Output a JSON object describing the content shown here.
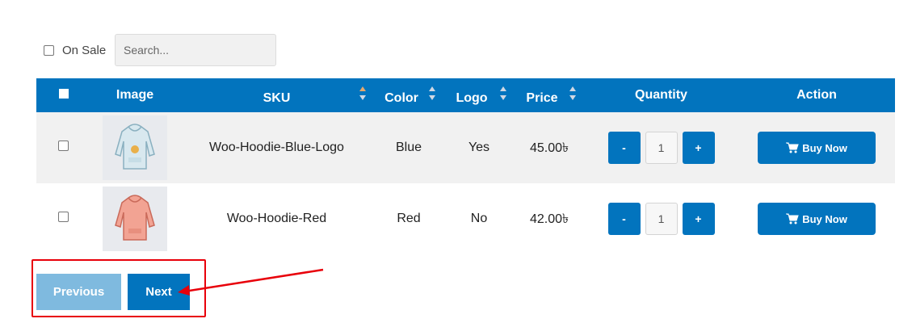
{
  "filters": {
    "on_sale_label": "On Sale",
    "search_placeholder": "Search..."
  },
  "table": {
    "headers": {
      "image": "Image",
      "sku": "SKU",
      "color": "Color",
      "logo": "Logo",
      "price": "Price",
      "quantity": "Quantity",
      "action": "Action"
    },
    "rows": [
      {
        "sku": "Woo-Hoodie-Blue-Logo",
        "color": "Blue",
        "logo": "Yes",
        "price": "45.00৳",
        "quantity": "1",
        "minus": "-",
        "plus": "+",
        "buy_label": "Buy Now",
        "image_icon": "hoodie-blue-icon"
      },
      {
        "sku": "Woo-Hoodie-Red",
        "color": "Red",
        "logo": "No",
        "price": "42.00৳",
        "quantity": "1",
        "minus": "-",
        "plus": "+",
        "buy_label": "Buy Now",
        "image_icon": "hoodie-red-icon"
      }
    ]
  },
  "pagination": {
    "previous_label": "Previous",
    "next_label": "Next"
  },
  "colors": {
    "accent": "#0274be",
    "accent_light": "#7fbadf",
    "annotation": "#e8000a"
  }
}
